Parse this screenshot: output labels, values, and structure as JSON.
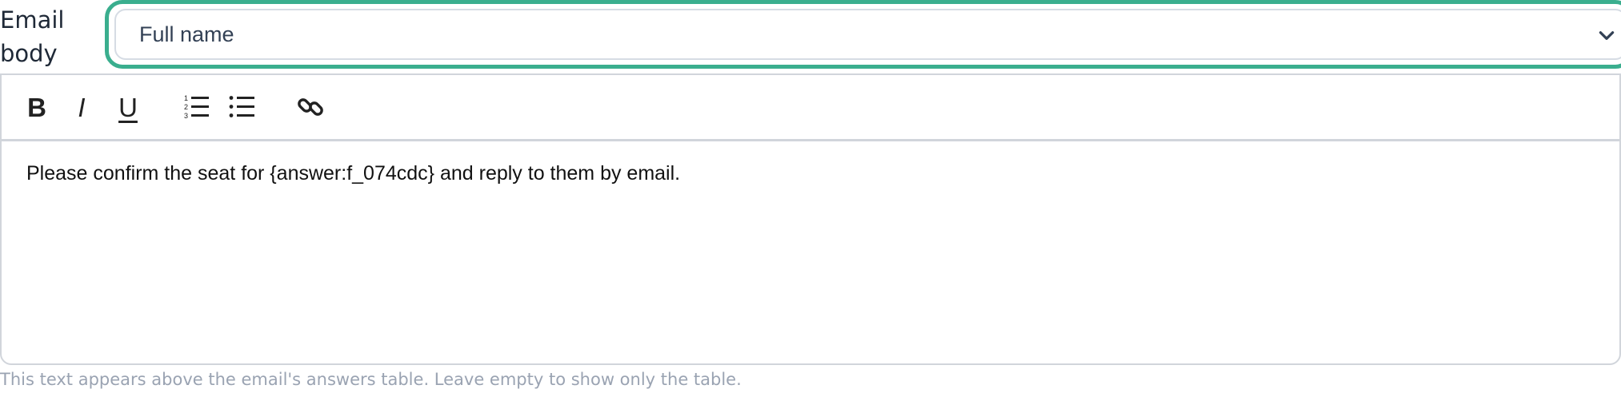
{
  "field": {
    "label": "Email body"
  },
  "select": {
    "value": "Full name",
    "focus_ring_color": "#3aae8e"
  },
  "toolbar": {
    "bold_label": "B",
    "italic_label": "I",
    "underline_label": "U",
    "buttons": [
      "bold",
      "italic",
      "underline",
      "ordered-list-icon",
      "bullet-list-icon",
      "link-icon"
    ]
  },
  "editor": {
    "content": "Please confirm the seat for {answer:f_074cdc} and reply to them by email."
  },
  "help": {
    "text": "This text appears above the email's answers table. Leave empty to show only the table."
  }
}
